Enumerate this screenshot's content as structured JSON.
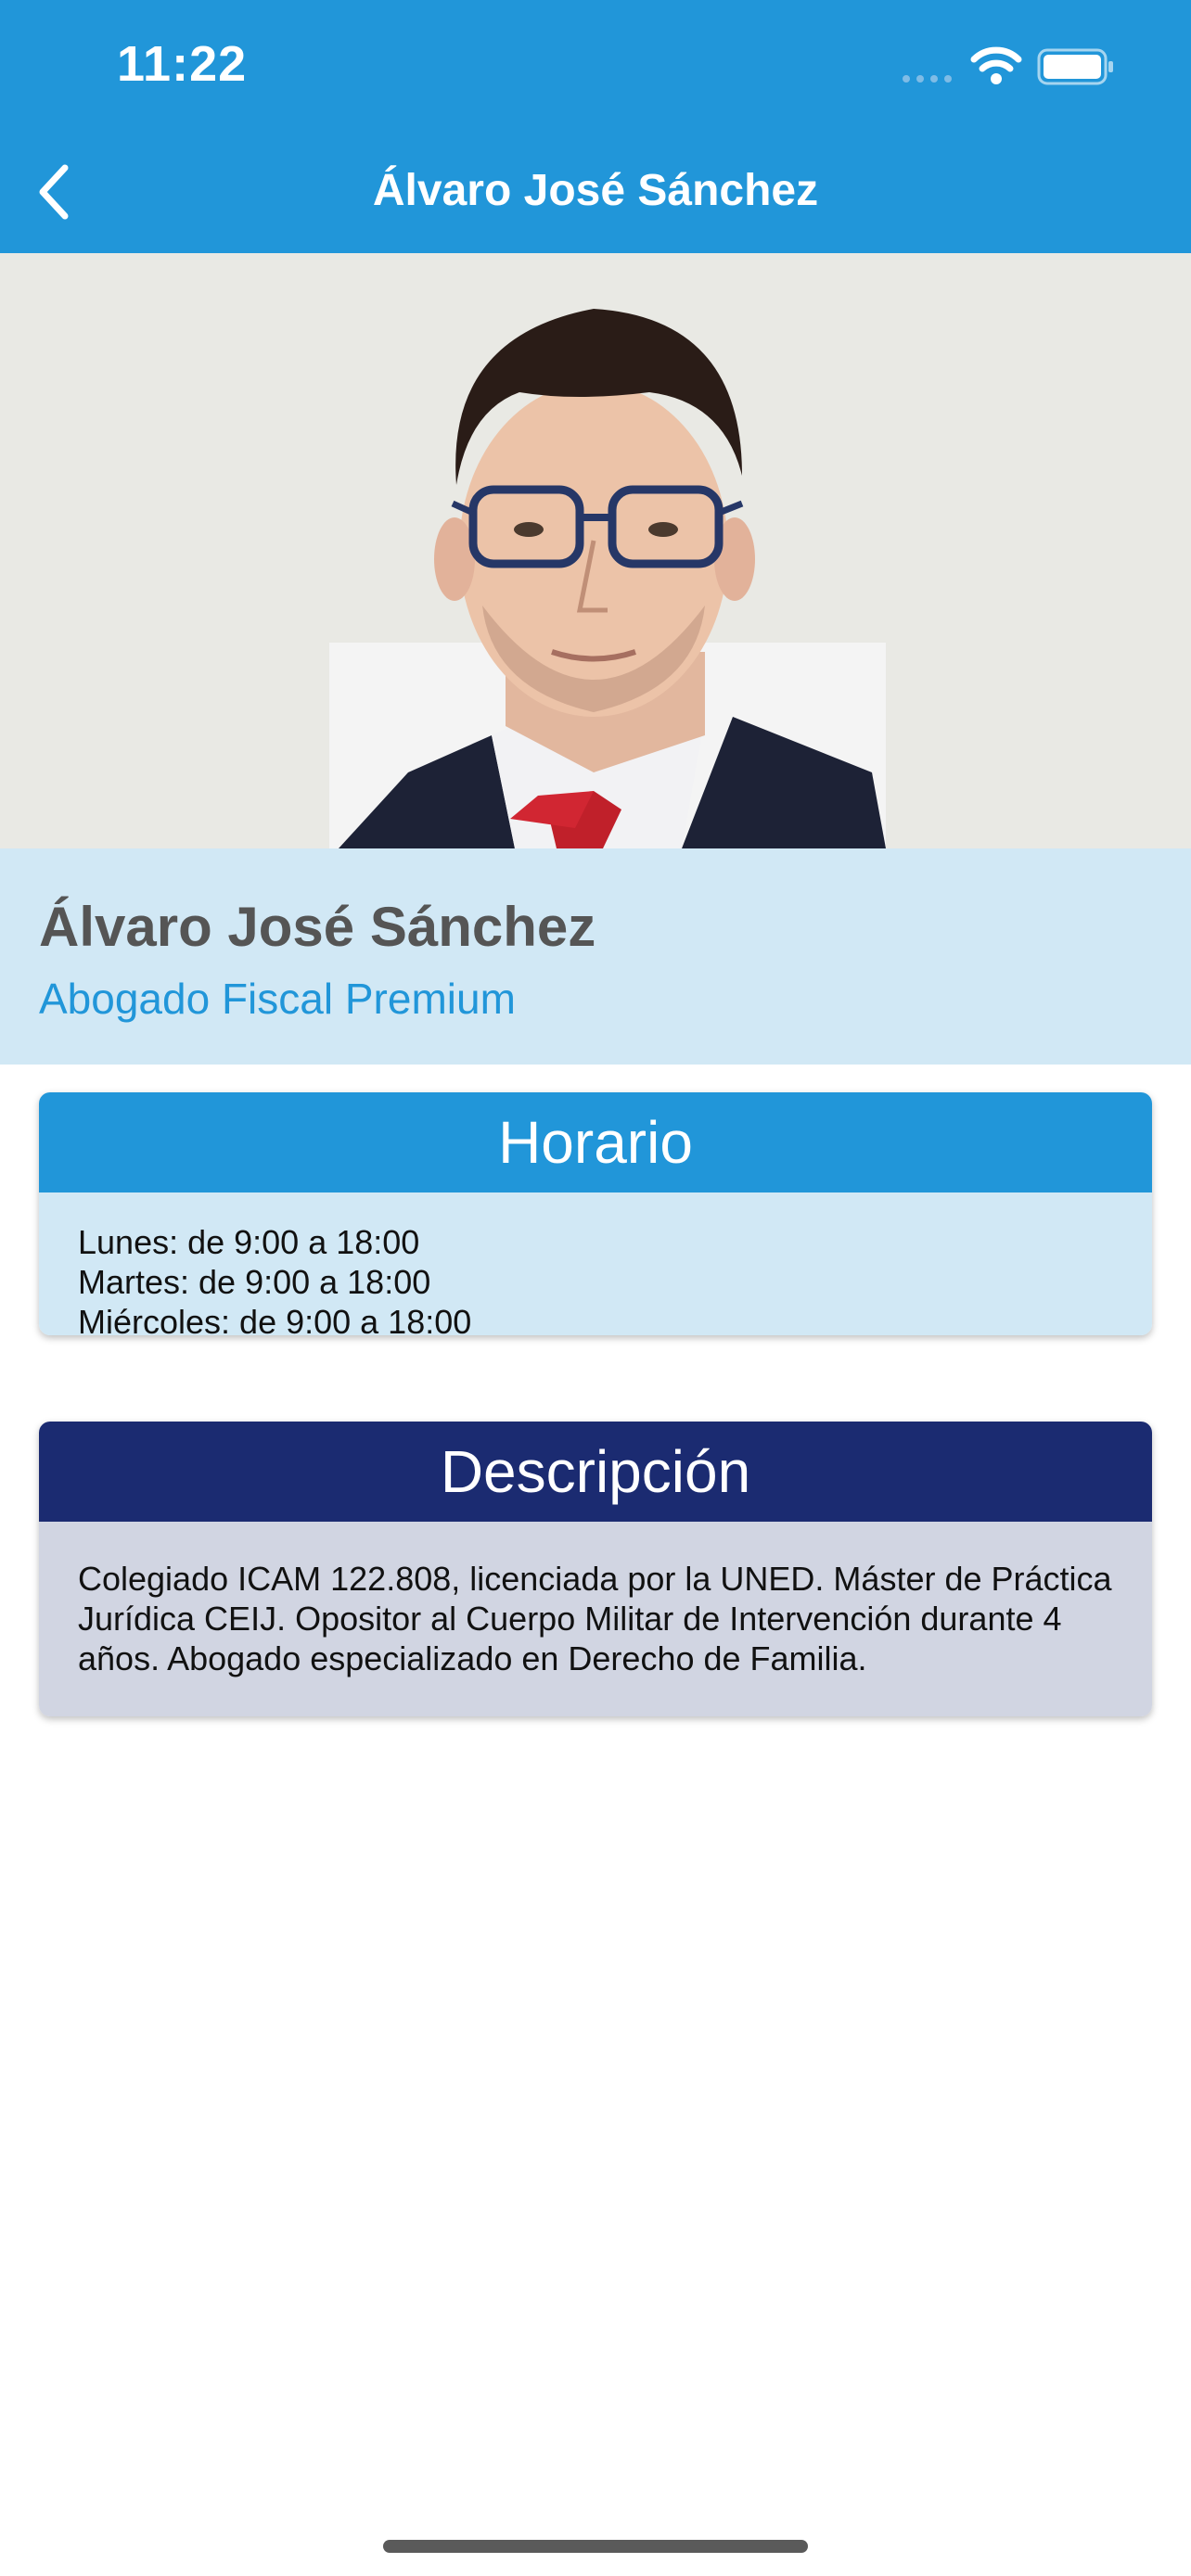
{
  "status_bar": {
    "time": "11:22",
    "icons": [
      "signal-icon",
      "wifi-icon",
      "battery-icon"
    ]
  },
  "nav": {
    "back_icon": "chevron-left-icon",
    "title": "Álvaro José Sánchez"
  },
  "profile": {
    "name": "Álvaro José Sánchez",
    "subtitle": "Abogado Fiscal Premium"
  },
  "schedule": {
    "title": "Horario",
    "lines": [
      "Lunes: de 9:00 a 18:00",
      "Martes: de 9:00 a 18:00",
      "Miércoles: de 9:00 a 18:00"
    ]
  },
  "description": {
    "title": "Descripción",
    "text": "Colegiado ICAM 122.808, licenciada por la UNED. Máster de Práctica Jurídica CEIJ. Opositor al Cuerpo Militar de Intervención durante 4 años. Abogado especializado en Derecho de Familia."
  },
  "colors": {
    "primary": "#2196d9",
    "primary_light": "#d1e8f5",
    "navy": "#1b2b71",
    "description_bg": "#d1d5e2"
  }
}
